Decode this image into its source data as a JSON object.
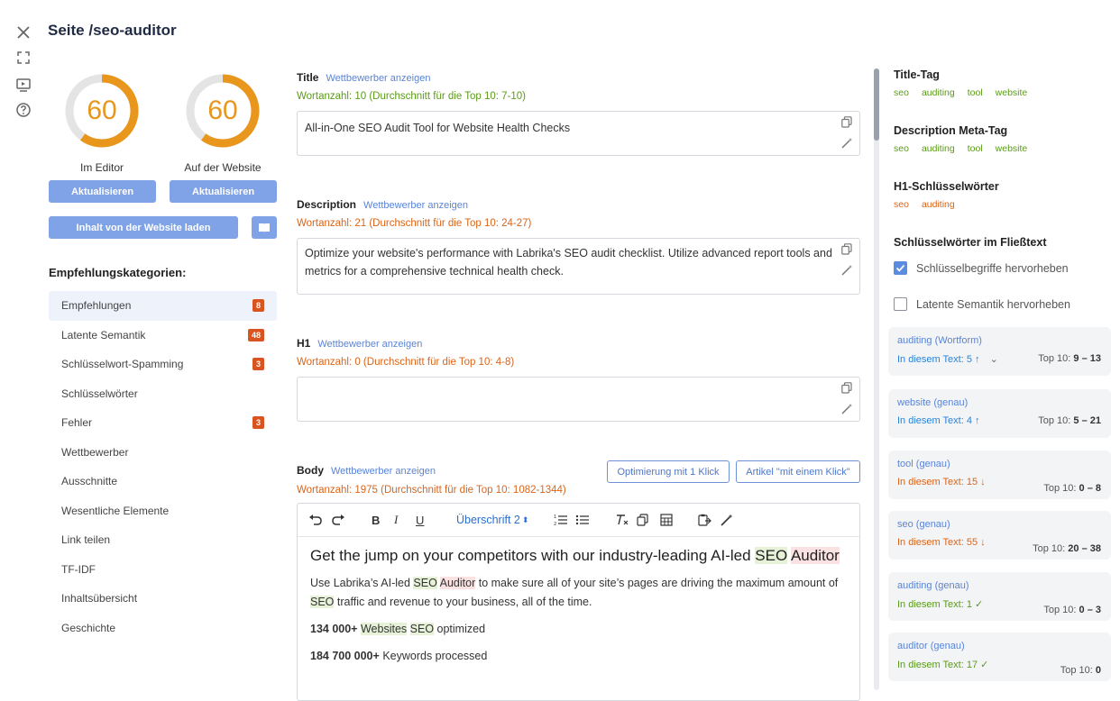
{
  "page": {
    "title": "Seite /seo-auditor"
  },
  "gauges": [
    {
      "value": "60",
      "label": "Im Editor",
      "button": "Aktualisieren"
    },
    {
      "value": "60",
      "label": "Auf der Website",
      "button": "Aktualisieren"
    }
  ],
  "load_button": "Inhalt von der Website laden",
  "categories": {
    "heading": "Empfehlungskategorien:",
    "items": [
      {
        "label": "Empfehlungen",
        "badge": "8"
      },
      {
        "label": "Latente Semantik",
        "badge": "48"
      },
      {
        "label": "Schlüsselwort-Spamming",
        "badge": "3"
      },
      {
        "label": "Schlüsselwörter",
        "badge": ""
      },
      {
        "label": "Fehler",
        "badge": "3"
      },
      {
        "label": "Wettbewerber",
        "badge": ""
      },
      {
        "label": "Ausschnitte",
        "badge": ""
      },
      {
        "label": "Wesentliche Elemente",
        "badge": ""
      },
      {
        "label": "Link teilen",
        "badge": ""
      },
      {
        "label": "TF-IDF",
        "badge": ""
      },
      {
        "label": "Inhaltsübersicht",
        "badge": ""
      },
      {
        "label": "Geschichte",
        "badge": ""
      }
    ]
  },
  "competitor_link": "Wettbewerber anzeigen",
  "title_field": {
    "label": "Title",
    "count": "Wortanzahl: 10 (Durchschnitt für die Top 10: 7-10)",
    "value": "All-in-One SEO Audit Tool for Website Health Checks"
  },
  "description_field": {
    "label": "Description",
    "count": "Wortanzahl: 21 (Durchschnitt für die Top 10: 24-27)",
    "value": "Optimize your website's performance with Labrika's SEO audit checklist. Utilize advanced report tools and metrics for a comprehensive technical health check."
  },
  "h1_field": {
    "label": "H1",
    "count": "Wortanzahl: 0 (Durchschnitt für die Top 10: 4-8)",
    "value": ""
  },
  "body_field": {
    "label": "Body",
    "count": "Wortanzahl: 1975 (Durchschnitt für die Top 10: 1082-1344)",
    "btn_optimize": "Optimierung mit 1 Klick",
    "btn_article": "Artikel \"mit einem Klick\"",
    "heading_select": "Überschrift 2",
    "heading_text": "Get the jump on your competitors with our industry-leading AI-led",
    "heading_hl1": "SEO",
    "heading_hl2": "Auditor",
    "p1_a": "Use Labrika’s AI-led",
    "p1_hl1": "SEO",
    "p1_hl2": "Auditor",
    "p1_b": "to make sure all of your site’s pages are driving the maximum amount of",
    "p1_hl3": "SEO",
    "p1_c": "traffic and revenue to your business, all of the time.",
    "p2_bold": "134 000+",
    "p2_hl1": "Websites",
    "p2_hl2": "SEO",
    "p2_rest": "optimized",
    "p3_bold": "184 700 000+",
    "p3_rest": "Keywords processed"
  },
  "right": {
    "title_tag": {
      "heading": "Title-Tag",
      "tags": [
        "seo",
        "auditing",
        "tool",
        "website"
      ]
    },
    "desc_tag": {
      "heading": "Description Meta-Tag",
      "tags": [
        "seo",
        "auditing",
        "tool",
        "website"
      ]
    },
    "h1_tag": {
      "heading": "H1-Schlüsselwörter",
      "tags": [
        "seo",
        "auditing"
      ]
    },
    "body_heading": "Schlüsselwörter im Fließtext",
    "chk1": "Schlüsselbegriffe hervorheben",
    "chk2": "Latente Semantik hervorheben",
    "keywords": [
      {
        "name": "auditing (Wortform)",
        "in_text": "In diesem Text: 5",
        "arrow": "↑",
        "top": "Top 10:",
        "range": "9 – 13",
        "color": "#2a82d8"
      },
      {
        "name": "website (genau)",
        "in_text": "In diesem Text: 4",
        "arrow": "↑",
        "top": "Top 10:",
        "range": "5 – 21",
        "color": "#2a82d8"
      },
      {
        "name": "tool (genau)",
        "in_text": "In diesem Text: 15",
        "arrow": "↓",
        "top": "Top 10:",
        "range": "0 – 8",
        "color": "#d9651a"
      },
      {
        "name": "seo (genau)",
        "in_text": "In diesem Text: 55",
        "arrow": "↓",
        "top": "Top 10:",
        "range": "20 – 38",
        "color": "#d9651a"
      },
      {
        "name": "auditing (genau)",
        "in_text": "In diesem Text: 1",
        "arrow": "✓",
        "top": "Top 10:",
        "range": "0 – 3",
        "color": "#5b9a1a"
      },
      {
        "name": "auditor (genau)",
        "in_text": "In diesem Text: 17",
        "arrow": "✓",
        "top": "Top 10:",
        "range": "0",
        "color": "#5b9a1a"
      }
    ]
  },
  "colors": {
    "accent": "#7fa3e6",
    "gauge": "#e8961c",
    "badge": "#d9541e",
    "ok": "#5b9a1a",
    "warn": "#d9651a",
    "info": "#2a82d8"
  },
  "gauge_fraction": 0.6
}
